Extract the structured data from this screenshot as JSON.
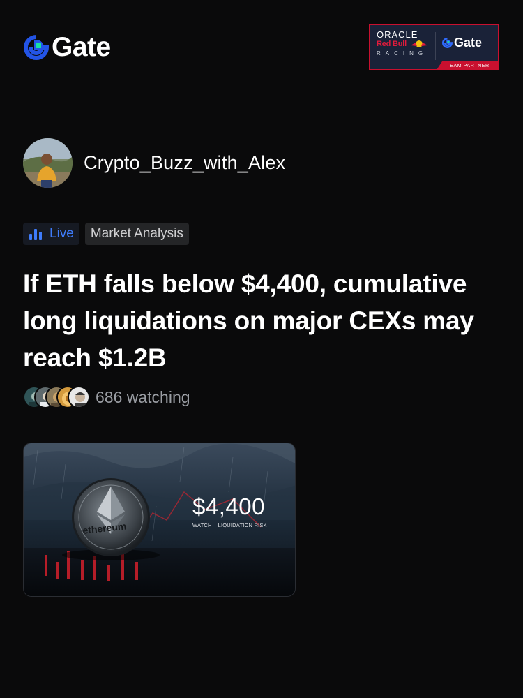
{
  "brand": {
    "name": "Gate",
    "accent": "#2354e6",
    "accent_green": "#17e0a0"
  },
  "partner": {
    "oracle": "ORACLE",
    "redbull": "Red Bull",
    "racing": "RACING",
    "gate": "Gate",
    "team": "TEAM PARTNER"
  },
  "author": {
    "name": "Crypto_Buzz_with_Alex"
  },
  "tags": {
    "live_label": "Live",
    "live_color": "#3e7bfa",
    "category": "Market Analysis"
  },
  "post": {
    "title": "If ETH falls below $4,400, cumulative long liquidations on major CEXs may reach $1.2B"
  },
  "watchers": {
    "count": "686",
    "label": "watching"
  },
  "media": {
    "price": "$4,400",
    "caption": "WATCH – LIQUIDATION RISK",
    "coin_text": "ethereum"
  }
}
